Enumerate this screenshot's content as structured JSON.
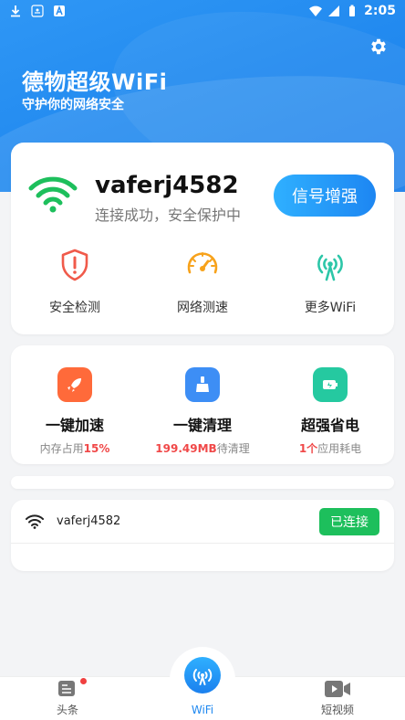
{
  "status_bar": {
    "time": "2:05"
  },
  "header": {
    "title": "德物超级WiFi",
    "subtitle": "守护你的网络安全",
    "settings_icon": "gear-icon"
  },
  "connection": {
    "ssid": "vaferj4582",
    "status": "连接成功，安全保护中",
    "boost_label": "信号增强",
    "wifi_color": "#1dbf5c"
  },
  "tools": [
    {
      "label": "安全检测",
      "icon": "shield-alert-icon"
    },
    {
      "label": "网络测速",
      "icon": "speedometer-icon"
    },
    {
      "label": "更多WiFi",
      "icon": "antenna-icon"
    }
  ],
  "features": [
    {
      "name": "一键加速",
      "highlight": "",
      "suffix": "15%",
      "prefix": "内存占用",
      "icon": "rocket-icon",
      "color": "#ff6a3a"
    },
    {
      "name": "一键清理",
      "highlight": "199.49MB",
      "suffix": "",
      "prefix": "待清理",
      "icon": "broom-icon",
      "color": "#3d8ef5"
    },
    {
      "name": "超强省电",
      "highlight": "1个",
      "suffix": "",
      "prefix": "应用耗电",
      "icon": "battery-icon",
      "color": "#25c9a0"
    }
  ],
  "network_list": [
    {
      "ssid": "vaferj4582",
      "action": "已连接"
    }
  ],
  "bottom_nav": [
    {
      "label": "头条",
      "icon": "news-icon",
      "badge": true
    },
    {
      "label": "WiFi",
      "icon": "wifi-antenna-icon",
      "active": true
    },
    {
      "label": "短视频",
      "icon": "video-icon"
    }
  ]
}
